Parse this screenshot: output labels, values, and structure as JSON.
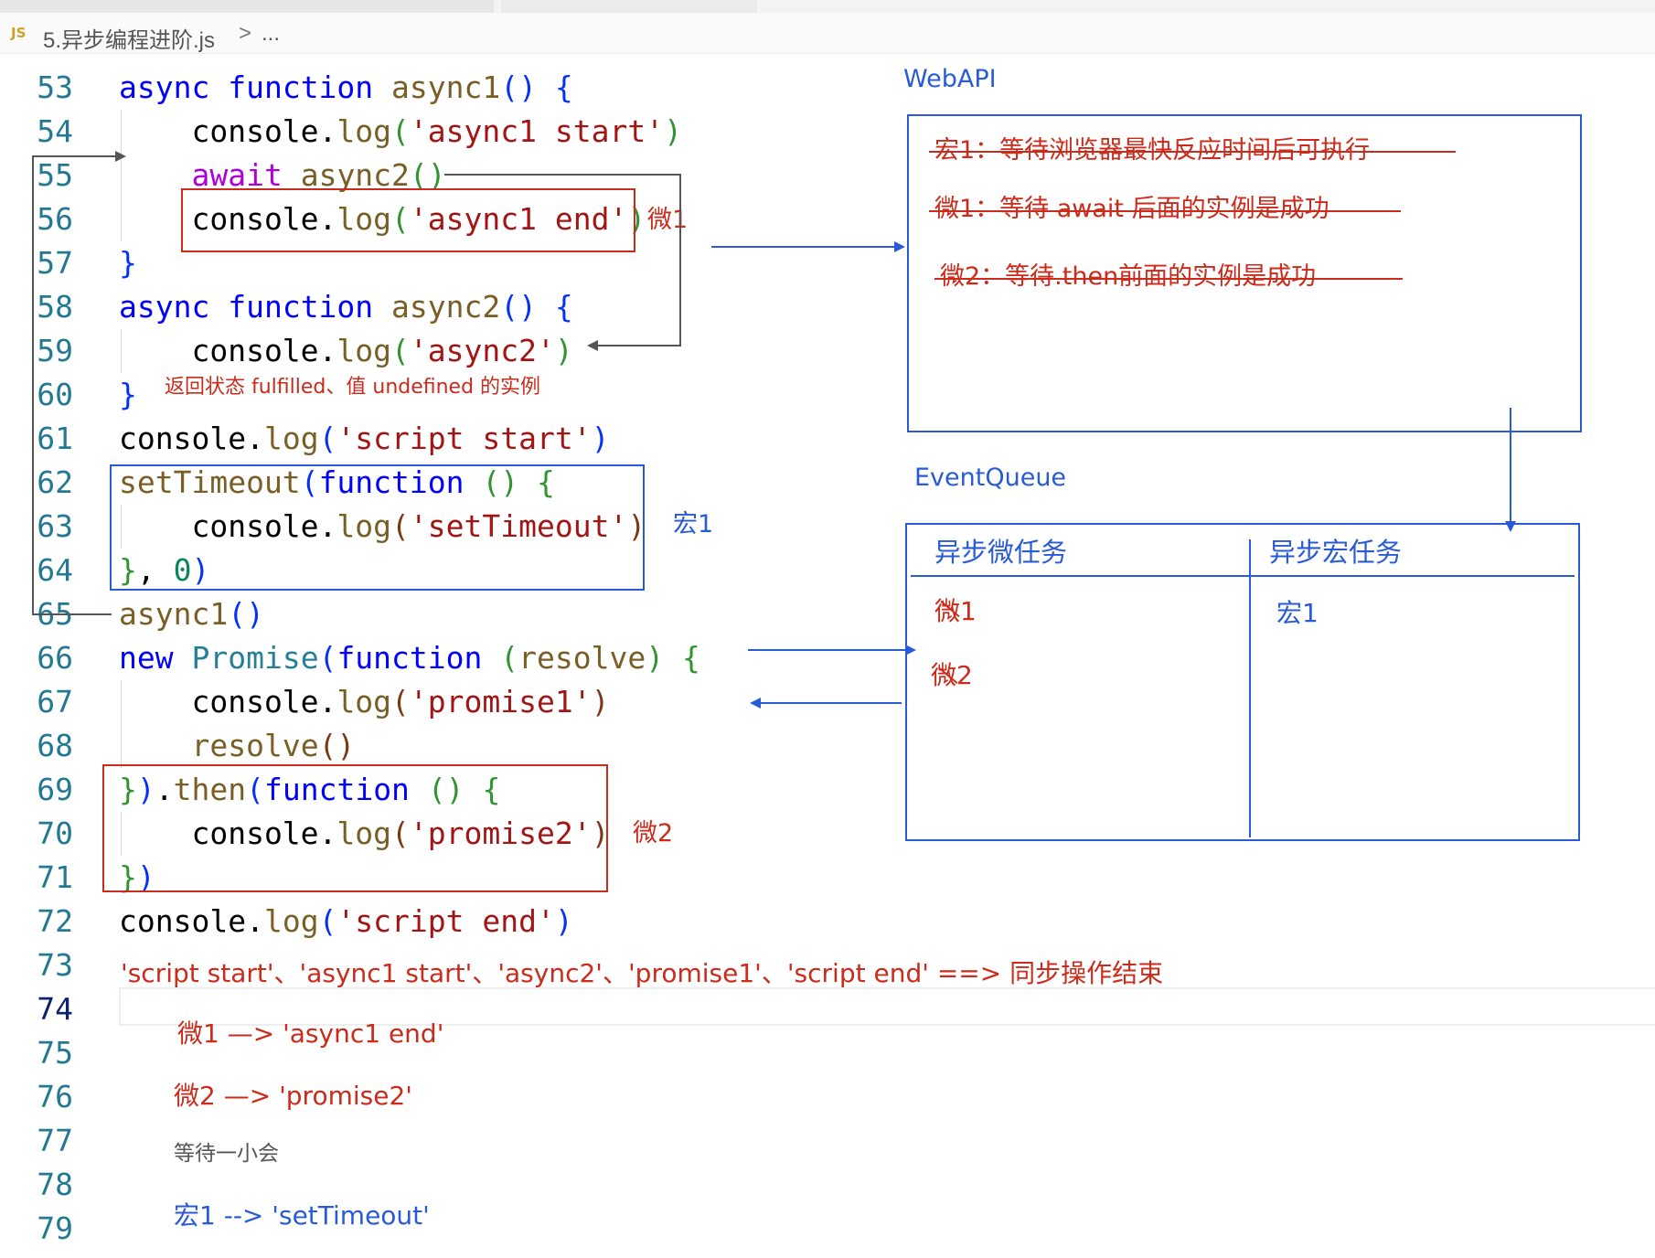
{
  "breadcrumb": {
    "file_badge": "JS",
    "file_name": "5.异步编程进阶.js",
    "separator": ">",
    "tail": "..."
  },
  "line_numbers": [
    "53",
    "54",
    "55",
    "56",
    "57",
    "58",
    "59",
    "60",
    "61",
    "62",
    "63",
    "64",
    "65",
    "66",
    "67",
    "68",
    "69",
    "70",
    "71",
    "72",
    "73",
    "74",
    "75",
    "76",
    "77",
    "78",
    "79"
  ],
  "annotations": {
    "micro1_tag": "微1",
    "async2_return": "返回状态 fulfilled、值 undefined 的实例",
    "macro1_tag": "宏1",
    "micro2_tag": "微2",
    "sync_done": "'script start'、'async1 start'、'async2'、'promise1'、'script end'  ==> 同步操作结束",
    "step1": "微1  —> 'async1 end'",
    "step2": "微2  —> 'promise2'",
    "wait": "等待一小会",
    "step3": "宏1 --> 'setTimeout'"
  },
  "webapi": {
    "title": "WebAPI",
    "items": [
      "宏1：等待浏览器最快反应时间后可执行",
      "微1：等待 await 后面的实例是成功",
      "微2：等待.then前面的实例是成功"
    ]
  },
  "eventqueue": {
    "title": "EventQueue",
    "micro_header": "异步微任务",
    "macro_header": "异步宏任务",
    "micro_items": [
      "微1",
      "微2"
    ],
    "macro_items": [
      "宏1"
    ]
  },
  "colors": {
    "red": "#cc2a1a",
    "blue": "#2a5bd7"
  }
}
